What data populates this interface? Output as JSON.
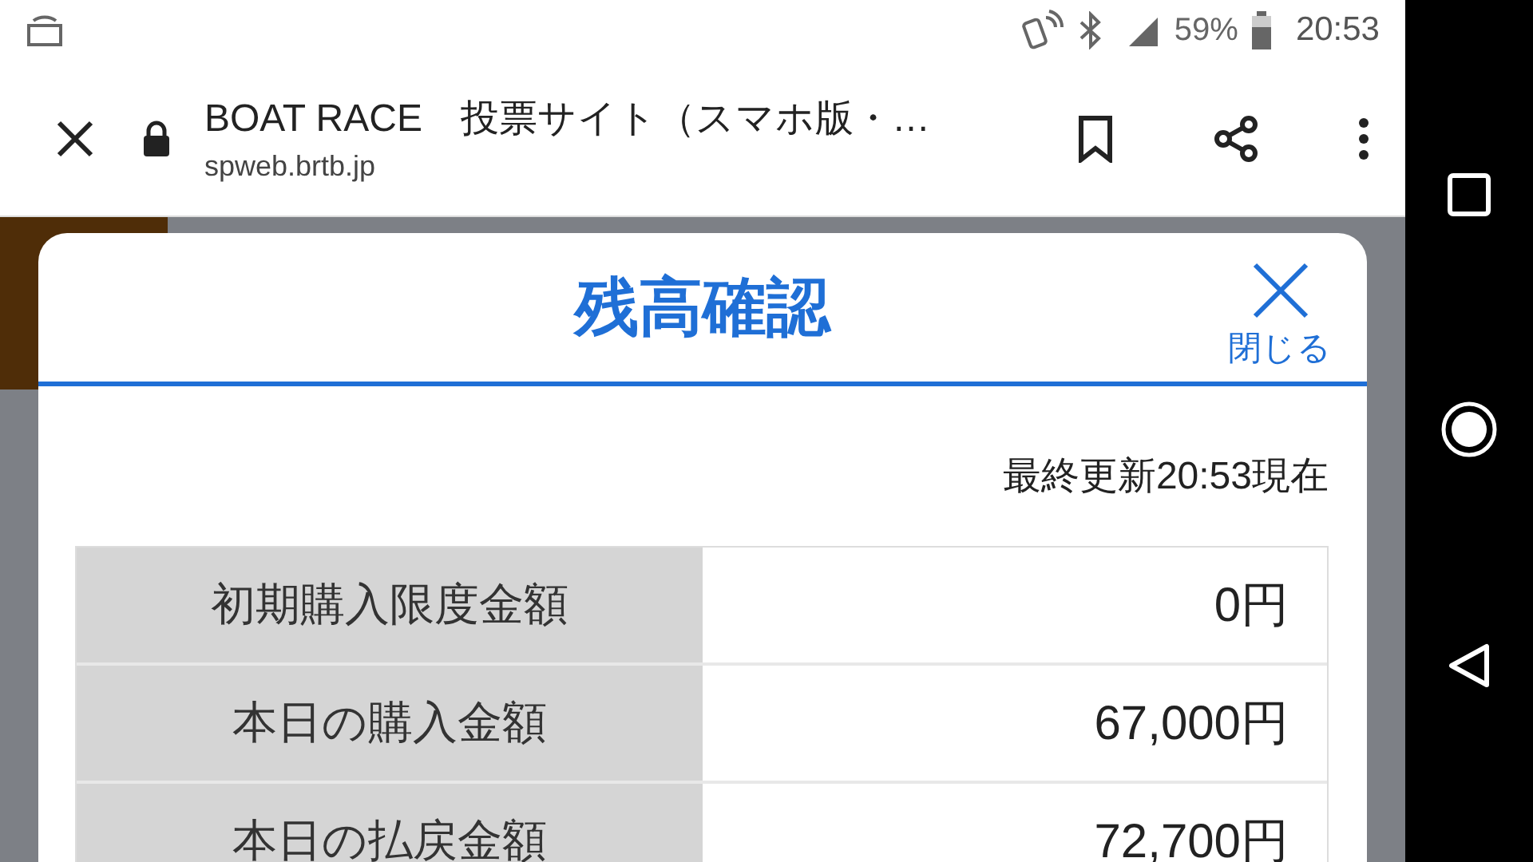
{
  "status_bar": {
    "battery": "59%",
    "time": "20:53"
  },
  "browser": {
    "title": "BOAT RACE　投票サイト（スマホ版・…",
    "url": "spweb.brtb.jp"
  },
  "dialog": {
    "title": "残高確認",
    "close_label": "閉じる",
    "updated": "最終更新20:53現在",
    "rows": [
      {
        "label": "初期購入限度金額",
        "value": "0円"
      },
      {
        "label": "本日の購入金額",
        "value": "67,000円"
      },
      {
        "label": "本日の払戻金額",
        "value": "72,700円"
      }
    ]
  }
}
